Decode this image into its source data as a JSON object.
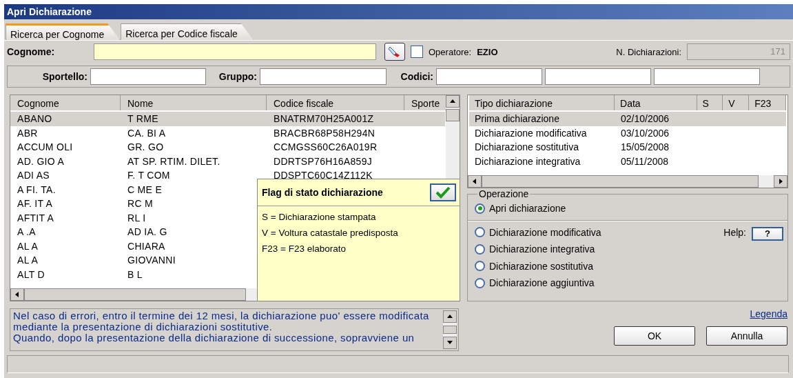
{
  "window": {
    "title": "Apri Dichiarazione"
  },
  "tabs": [
    {
      "label": "Ricerca per Cognome",
      "selected": true
    },
    {
      "label": "Ricerca per Codice fiscale",
      "selected": false
    }
  ],
  "search": {
    "label": "Cognome:",
    "operator": {
      "checked": false,
      "label": "Operatore:",
      "name": "EZIO"
    },
    "count_label": "N. Dichiarazioni:",
    "count": "171"
  },
  "filters": {
    "sportello_label": "Sportello:",
    "gruppo_label": "Gruppo:",
    "codici_label": "Codici:"
  },
  "people_table": {
    "columns": [
      "Cognome",
      "Nome",
      "Codice fiscale",
      "Sporte"
    ],
    "rows": [
      {
        "cognome": "ABANO",
        "nome": "T RME",
        "codice_fiscale": "BNATRM70H25A001Z",
        "selected": true
      },
      {
        "cognome": "ABR",
        "nome": "CA. BI A",
        "codice_fiscale": "BRACBR68P58H294N",
        "selected": false
      },
      {
        "cognome": "ACCUM OLI",
        "nome": "GR. GO",
        "codice_fiscale": "CCMGSS60C26A019R",
        "selected": false
      },
      {
        "cognome": "AD. GIO A",
        "nome": "AT SP. RTIM. DILET.",
        "codice_fiscale": "DDRTSP76H16A859J",
        "selected": false
      },
      {
        "cognome": "ADI AS",
        "nome": "F. T COM",
        "codice_fiscale": "DDSPTC60C14Z112K",
        "selected": false
      },
      {
        "cognome": "A FI. TA.",
        "nome": "C ME E",
        "selected": false
      },
      {
        "cognome": "AF. IT A",
        "nome": "RC M",
        "selected": false
      },
      {
        "cognome": "AFTIT A",
        "nome": "RL I",
        "selected": false
      },
      {
        "cognome": "A .A",
        "nome": "AD IA. G",
        "selected": false
      },
      {
        "cognome": "AL A",
        "nome": "CHIARA",
        "selected": false
      },
      {
        "cognome": "AL A",
        "nome": "GIOVANNI",
        "selected": false
      },
      {
        "cognome": "ALT D",
        "nome": "B L",
        "selected": false
      }
    ]
  },
  "flag_popup": {
    "title": "Flag di stato dichiarazione",
    "lines": [
      "S = Dichiarazione stampata",
      "V = Voltura catastale predisposta",
      "F23 = F23 elaborato"
    ]
  },
  "declarations_table": {
    "columns": [
      "Tipo dichiarazione",
      "Data",
      "S",
      "V",
      "F23"
    ],
    "rows": [
      {
        "tipo": "Prima dichiarazione",
        "data": "02/10/2006",
        "selected": true
      },
      {
        "tipo": "Dichiarazione modificativa",
        "data": "03/10/2006",
        "selected": false
      },
      {
        "tipo": "Dichiarazione sostitutiva",
        "data": "15/05/2008",
        "selected": false
      },
      {
        "tipo": "Dichiarazione integrativa",
        "data": "05/11/2008",
        "selected": false
      }
    ]
  },
  "operation": {
    "legend": "Operazione",
    "help_label": "Help:",
    "help_button": "?",
    "options": [
      {
        "label": "Apri dichiarazione",
        "selected": true
      },
      {
        "label": "Dichiarazione modificativa",
        "selected": false
      },
      {
        "label": "Dichiarazione integrativa",
        "selected": false
      },
      {
        "label": "Dichiarazione sostitutiva",
        "selected": false
      },
      {
        "label": "Dichiarazione aggiuntiva",
        "selected": false
      }
    ]
  },
  "info_text": [
    "Nel caso di errori, entro il termine dei 12 mesi, la dichiarazione puo' essere modificata mediante la presentazione di dichiarazioni sostitutive.",
    "Quando, dopo la presentazione della dichiarazione di successione, sopravviene un"
  ],
  "legend_link": "Legenda",
  "buttons": [
    "OK",
    "Annulla"
  ]
}
